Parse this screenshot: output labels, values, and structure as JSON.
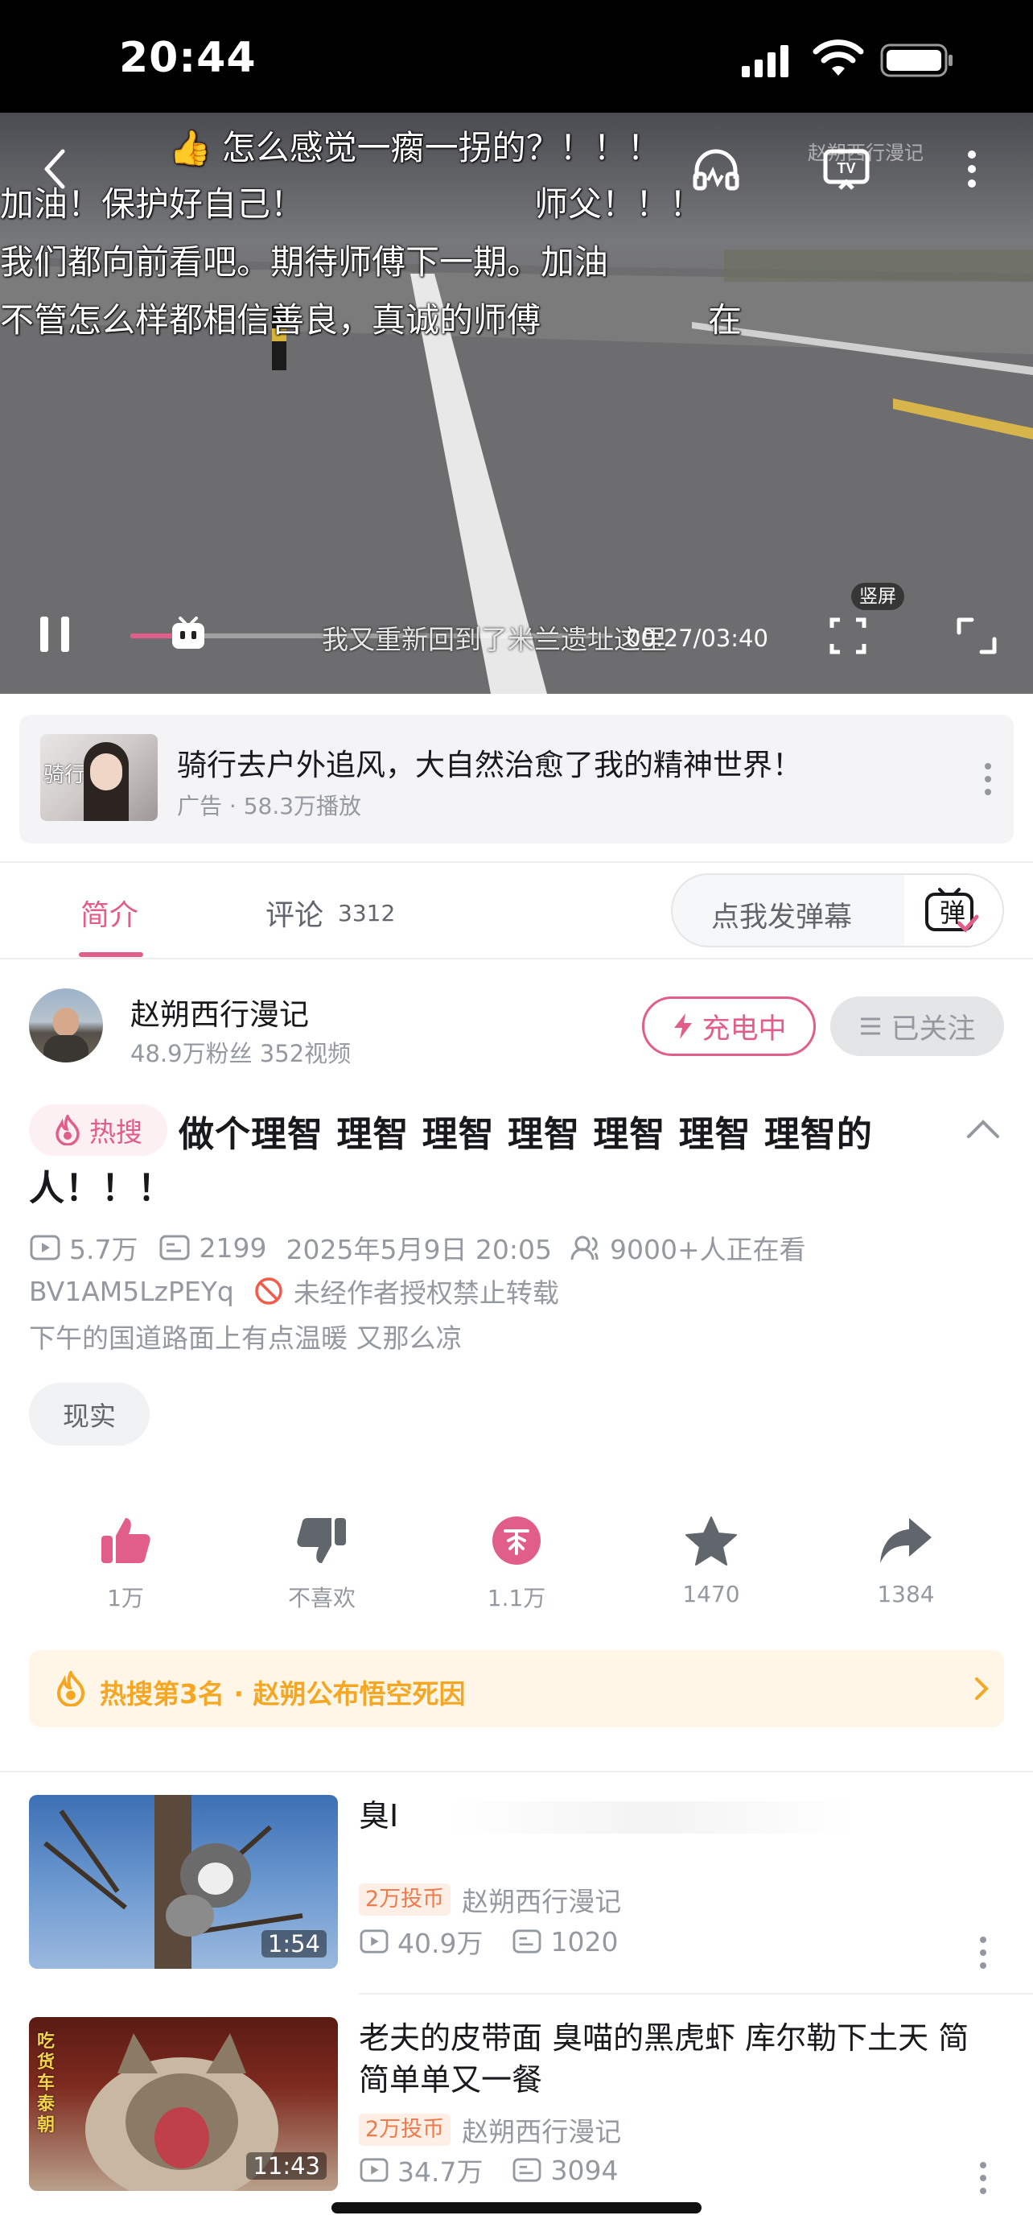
{
  "status_bar": {
    "time": "20:44"
  },
  "player": {
    "danmaku": [
      "👍 怎么感觉一瘸一拐的？！！！",
      "加油！保护好自己！",
      "师父！！！",
      "我们都向前看吧。期待师傅下一期。加油",
      "不管怎么样都相信善良，真诚的师傅",
      "在"
    ],
    "watermark": "赵朔西行漫记",
    "subtitle": "我又重新回到了米兰遗址这里",
    "time_display": "00:27/03:40",
    "progress": 0.12,
    "portrait_label": "竖屏"
  },
  "ad": {
    "title": "骑行去户外追风，大自然治愈了我的精神世界！",
    "subtitle": "广告 · 58.3万播放",
    "thumb_text": "骑行"
  },
  "tabs": {
    "intro": "简介",
    "comments": "评论",
    "comments_count": "3312",
    "danmu_placeholder": "点我发弹幕",
    "danmu_icon_text": "弹"
  },
  "uploader": {
    "name": "赵朔西行漫记",
    "stats": "48.9万粉丝  352视频",
    "charge_label": "充电中",
    "follow_label": "已关注"
  },
  "video": {
    "hot_badge": "热搜",
    "title_line1": "做个理智 理智 理智 理智 理智 理智 理智的",
    "title_line2": "人！！！",
    "views": "5.7万",
    "danmaku_count": "2199",
    "date": "2025年5月9日 20:05",
    "watching": "9000+人正在看",
    "bvid": "BV1AM5LzPEYq",
    "copyright": "未经作者授权禁止转载",
    "description": "下午的国道路面上有点温暖 又那么凉",
    "tag": "现实"
  },
  "actions": {
    "like": "1万",
    "dislike": "不喜欢",
    "coin": "1.1万",
    "favorite": "1470",
    "share": "1384"
  },
  "hot_rank": {
    "text": "热搜第3名 · 赵朔公布悟空死因"
  },
  "related": [
    {
      "title": "臭I",
      "duration": "1:54",
      "coin_badge": "2万投币",
      "up": "赵朔西行漫记",
      "views": "40.9万",
      "danmaku": "1020"
    },
    {
      "title": "老夫的皮带面  臭喵的黑虎虾  库尔勒下土天  简简单单又一餐",
      "duration": "11:43",
      "coin_badge": "2万投币",
      "up": "赵朔西行漫记",
      "views": "34.7万",
      "danmaku": "3094",
      "thumb_text": "吃货车泰朝"
    }
  ],
  "colors": {
    "brand_pink": "#e15d8a",
    "hot_orange": "#f5a623",
    "coin_orange": "#ef7b4c"
  }
}
